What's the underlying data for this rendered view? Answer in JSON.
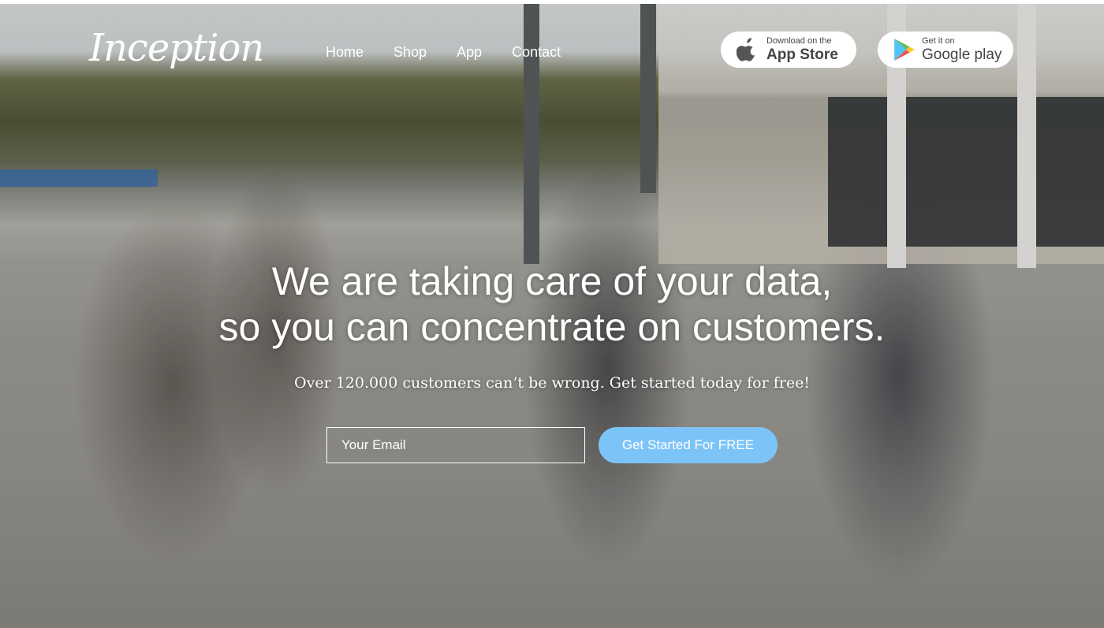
{
  "header": {
    "logo": "Inception",
    "nav": [
      "Home",
      "Shop",
      "App",
      "Contact"
    ]
  },
  "stores": {
    "apple": {
      "small": "Download on the",
      "big": "App Store",
      "icon": "apple-icon"
    },
    "google": {
      "small": "Get it on",
      "big": "Google play",
      "icon": "google-play-icon"
    }
  },
  "hero": {
    "headline_line1": "We are taking care of your data,",
    "headline_line2": "so you can concentrate on customers.",
    "subline": "Over 120.000 customers can’t be wrong. Get started today for free!",
    "email_placeholder": "Your Email",
    "cta_label": "Get Started For FREE"
  },
  "colors": {
    "cta": "#7cc4f7",
    "text": "#ffffff"
  }
}
